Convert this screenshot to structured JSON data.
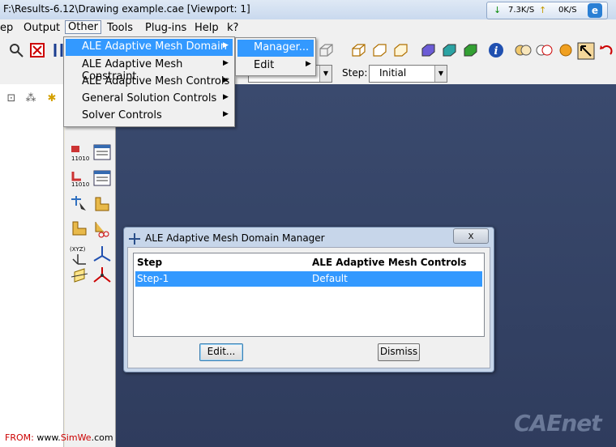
{
  "window": {
    "title": "F:\\Results-6.12\\Drawing example.cae [Viewport: 1]"
  },
  "netmon": {
    "down": "7.3K/S",
    "up": "0K/S"
  },
  "menubar": {
    "items": [
      "ep",
      "Output",
      "Other",
      "Tools",
      "Plug-ins",
      "Help",
      "k?"
    ]
  },
  "context": {
    "step_label": "Step:",
    "step_value": "Initial"
  },
  "other_menu": {
    "items": [
      "ALE Adaptive Mesh Domain",
      "ALE Adaptive Mesh Constraint",
      "ALE Adaptive Mesh Controls",
      "General Solution Controls",
      "Solver Controls"
    ]
  },
  "submenu": {
    "items": [
      "Manager...",
      "Edit"
    ]
  },
  "dialog": {
    "title": "ALE Adaptive Mesh Domain Manager",
    "close": "x",
    "columns": [
      "Step",
      "ALE Adaptive Mesh Controls"
    ],
    "rows": [
      {
        "step": "Step-1",
        "controls": "Default"
      }
    ],
    "edit_button": "Edit...",
    "dismiss_button": "Dismiss"
  },
  "footer": {
    "from": "FROM:",
    "site_prefix": "www.",
    "site_brand": "SimWe",
    "site_suffix": ".com"
  },
  "watermark": "CAEnet"
}
